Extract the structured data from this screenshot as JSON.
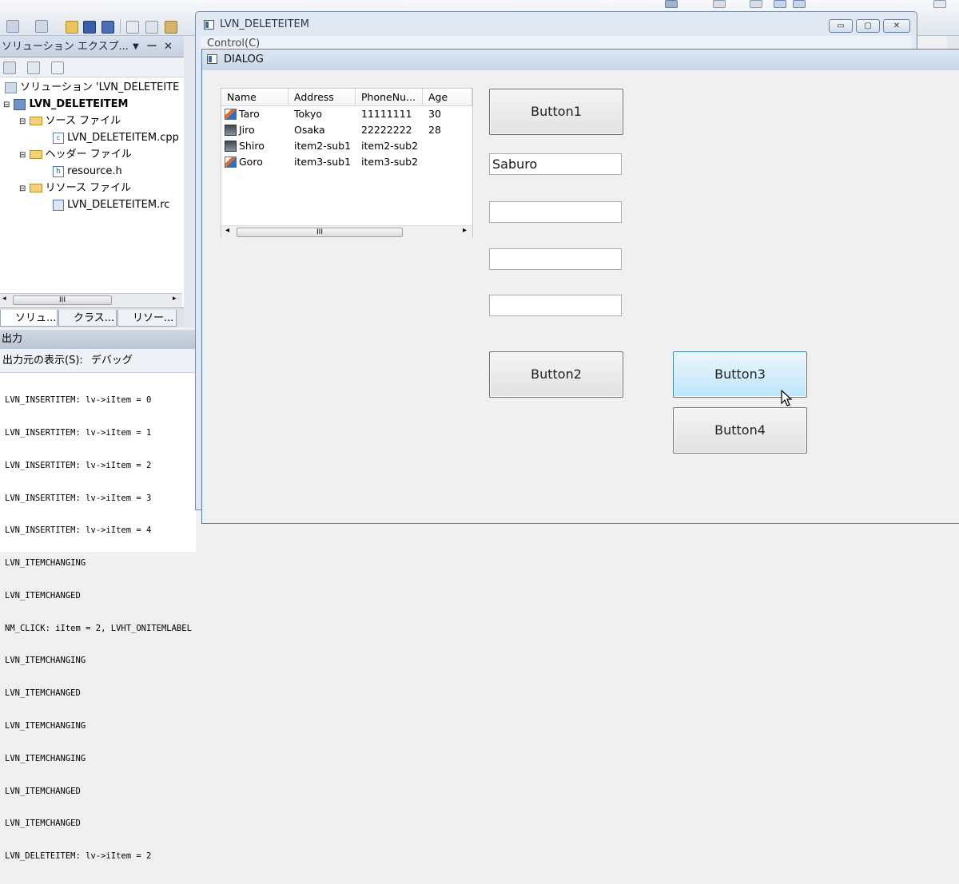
{
  "ide": {
    "solution_explorer": {
      "title": "ソリューション エクスプ...",
      "title_buttons": {
        "dropdown": "▼",
        "pin": "ᅳ",
        "close": "✕"
      },
      "tree": {
        "solution": "ソリューション 'LVN_DELETEITE",
        "project": "LVN_DELETEITEM",
        "folders": [
          {
            "label": "ソース ファイル",
            "file": "LVN_DELETEITEM.cpp"
          },
          {
            "label": "ヘッダー ファイル",
            "file": "resource.h"
          },
          {
            "label": "リソース ファイル",
            "file": "LVN_DELETEITEM.rc"
          }
        ]
      },
      "scroll_thumb": "III",
      "tabs": [
        "ソリュ...",
        "クラス...",
        "リソー..."
      ]
    },
    "output": {
      "title": "出力",
      "source_label": "出力元の表示(S):",
      "source_value": "デバッグ",
      "lines": [
        "LVN_INSERTITEM: lv->iItem = 0",
        "LVN_INSERTITEM: lv->iItem = 1",
        "LVN_INSERTITEM: lv->iItem = 2",
        "LVN_INSERTITEM: lv->iItem = 3",
        "LVN_INSERTITEM: lv->iItem = 4",
        "LVN_ITEMCHANGING",
        "LVN_ITEMCHANGED",
        "NM_CLICK: iItem = 2, LVHT_ONITEMLABEL",
        "LVN_ITEMCHANGING",
        "LVN_ITEMCHANGED",
        "LVN_ITEMCHANGING",
        "LVN_ITEMCHANGING",
        "LVN_ITEMCHANGED",
        "LVN_ITEMCHANGED",
        "LVN_DELETEITEM: lv->iItem = 2"
      ]
    }
  },
  "main_window": {
    "title": "LVN_DELETEITEM",
    "menu": "Control(C)",
    "buttons": {
      "minimize": "▭",
      "maximize": "▢",
      "close": "✕"
    }
  },
  "dialog": {
    "title": "DIALOG",
    "listview": {
      "columns": [
        "Name",
        "Address",
        "PhoneNu...",
        "Age"
      ],
      "rows": [
        {
          "name": "Taro",
          "address": "Tokyo",
          "phone": "11111111",
          "age": "30",
          "icon": "pencil-icon"
        },
        {
          "name": "Jiro",
          "address": "Osaka",
          "phone": "22222222",
          "age": "28",
          "icon": "monitor-icon"
        },
        {
          "name": "Shiro",
          "address": "item2-sub1",
          "phone": "item2-sub2",
          "age": "",
          "icon": "monitor-icon"
        },
        {
          "name": "Goro",
          "address": "item3-sub1",
          "phone": "item3-sub2",
          "age": "",
          "icon": "pencil-icon"
        }
      ],
      "scroll_left": "◂",
      "scroll_right": "▸",
      "scroll_thumb": "III"
    },
    "button1": "Button1",
    "edit1": "Saburo",
    "edit2": "",
    "edit3": "",
    "edit4": "",
    "button2": "Button2",
    "button3": "Button3",
    "button4": "Button4"
  }
}
